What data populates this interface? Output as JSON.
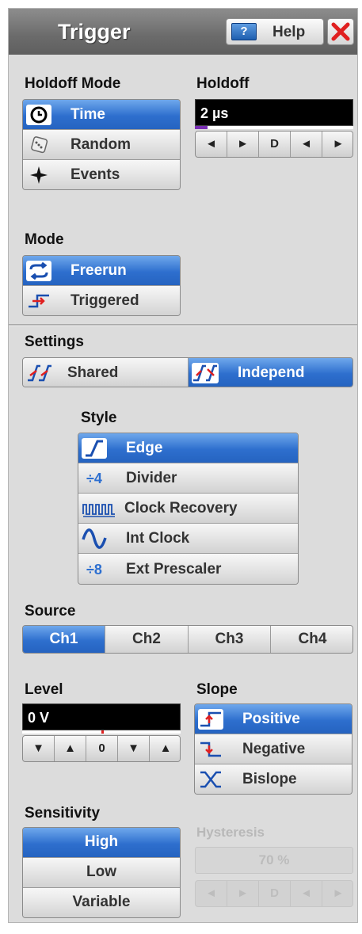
{
  "window": {
    "title": "Trigger",
    "help_label": "Help",
    "close_icon": "close-x-icon"
  },
  "holdoff_mode": {
    "label": "Holdoff Mode",
    "options": [
      {
        "label": "Time",
        "icon": "clock-icon",
        "selected": true
      },
      {
        "label": "Random",
        "icon": "dice-icon",
        "selected": false
      },
      {
        "label": "Events",
        "icon": "events-icon",
        "selected": false
      }
    ]
  },
  "holdoff": {
    "label": "Holdoff",
    "value": "2 µs",
    "level": 0.08,
    "steppers": [
      "◄",
      "►",
      "D",
      "◄",
      "►"
    ]
  },
  "mode": {
    "label": "Mode",
    "options": [
      {
        "label": "Freerun",
        "icon": "freerun-icon",
        "selected": true
      },
      {
        "label": "Triggered",
        "icon": "triggered-icon",
        "selected": false
      }
    ]
  },
  "settings": {
    "label": "Settings",
    "options": [
      {
        "label": "Shared",
        "icon": "shared-icon",
        "selected": false
      },
      {
        "label": "Independ",
        "icon": "independ-icon",
        "selected": true
      }
    ]
  },
  "style": {
    "label": "Style",
    "options": [
      {
        "label": "Edge",
        "icon": "edge-icon",
        "selected": true
      },
      {
        "label": "Divider",
        "icon_text": "÷4",
        "selected": false
      },
      {
        "label": "Clock Recovery",
        "icon": "clock-recovery-icon",
        "selected": false
      },
      {
        "label": "Int Clock",
        "icon": "sine-icon",
        "selected": false
      },
      {
        "label": "Ext Prescaler",
        "icon_text": "÷8",
        "selected": false
      }
    ]
  },
  "source": {
    "label": "Source",
    "options": [
      {
        "label": "Ch1",
        "selected": true
      },
      {
        "label": "Ch2",
        "selected": false
      },
      {
        "label": "Ch3",
        "selected": false
      },
      {
        "label": "Ch4",
        "selected": false
      }
    ]
  },
  "level": {
    "label": "Level",
    "value": "0 V",
    "marker": 0.5,
    "steppers": [
      "▼",
      "▲",
      "0",
      "▼",
      "▲"
    ]
  },
  "slope": {
    "label": "Slope",
    "options": [
      {
        "label": "Positive",
        "icon": "positive-slope-icon",
        "selected": true
      },
      {
        "label": "Negative",
        "icon": "negative-slope-icon",
        "selected": false
      },
      {
        "label": "Bislope",
        "icon": "bislope-icon",
        "selected": false
      }
    ]
  },
  "sensitivity": {
    "label": "Sensitivity",
    "options": [
      {
        "label": "High",
        "selected": true
      },
      {
        "label": "Low",
        "selected": false
      },
      {
        "label": "Variable",
        "selected": false
      }
    ]
  },
  "hysteresis": {
    "label": "Hysteresis",
    "value": "70 %",
    "steppers": [
      "◄",
      "►",
      "D",
      "◄",
      "►"
    ]
  },
  "colors": {
    "selected": "#2e6fce",
    "panel": "#dcdcdc",
    "title_bar": "#6b6b6b"
  }
}
